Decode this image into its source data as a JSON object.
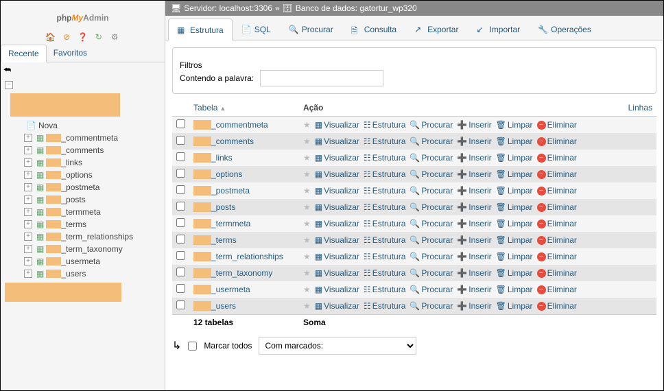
{
  "logo": {
    "part1": "php",
    "part2": "My",
    "part3": "Admin"
  },
  "quick_icons": [
    "home-icon",
    "sql-icon",
    "docs-icon",
    "refresh-icon",
    "gear-icon"
  ],
  "sidebar_tabs": {
    "recent": "Recente",
    "fav": "Favoritos"
  },
  "tree": {
    "new": "Nova",
    "tables": [
      "_commentmeta",
      "_comments",
      "_links",
      "_options",
      "_postmeta",
      "_posts",
      "_termmeta",
      "_terms",
      "_term_relationships",
      "_term_taxonomy",
      "_usermeta",
      "_users"
    ]
  },
  "breadcrumb": {
    "server_label": "Servidor:",
    "server": "localhost:3306",
    "sep": "»",
    "db_label": "Banco de dados:",
    "db": "gatortur_wp320"
  },
  "tabs": [
    {
      "label": "Estrutura",
      "active": true
    },
    {
      "label": "SQL"
    },
    {
      "label": "Procurar"
    },
    {
      "label": "Consulta"
    },
    {
      "label": "Exportar"
    },
    {
      "label": "Importar"
    },
    {
      "label": "Operações"
    }
  ],
  "filter": {
    "legend": "Filtros",
    "label": "Contendo a palavra:",
    "value": ""
  },
  "columns": {
    "tabela": "Tabela",
    "acao": "Ação",
    "linhas": "Linhas"
  },
  "actions": {
    "view": "Visualizar",
    "struct": "Estrutura",
    "search": "Procurar",
    "insert": "Inserir",
    "empty": "Limpar",
    "drop": "Eliminar"
  },
  "rows": [
    {
      "name": "_commentmeta"
    },
    {
      "name": "_comments"
    },
    {
      "name": "_links"
    },
    {
      "name": "_options"
    },
    {
      "name": "_postmeta"
    },
    {
      "name": "_posts"
    },
    {
      "name": "_termmeta"
    },
    {
      "name": "_terms"
    },
    {
      "name": "_term_relationships"
    },
    {
      "name": "_term_taxonomy"
    },
    {
      "name": "_usermeta"
    },
    {
      "name": "_users"
    }
  ],
  "footer": {
    "count": "12 tabelas",
    "sum": "Soma"
  },
  "bulk": {
    "check_all": "Marcar todos",
    "dropdown": "Com marcados:"
  }
}
